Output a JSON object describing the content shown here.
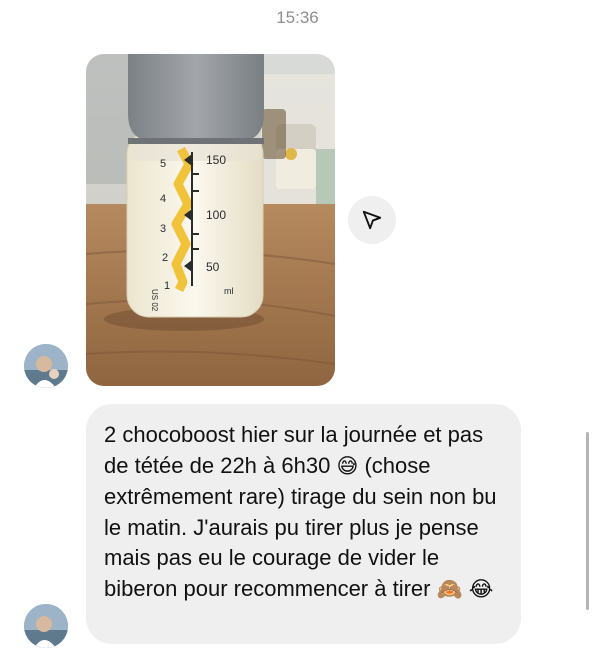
{
  "conversation": {
    "timestamp": "15:36",
    "photo": {
      "bottle_scale_left": [
        "5",
        "4",
        "3",
        "2",
        "1"
      ],
      "bottle_scale_right": [
        "150",
        "100",
        "50"
      ],
      "bottle_unit": "ml",
      "bottle_side_mark": "US 02",
      "fill_level_fraction": 0.93
    },
    "message": {
      "text": "2 chocoboost hier sur la journée et pas de tétée de 22h à 6h30 ",
      "emoji_1": "😅",
      "text_2": " (chose extrêmement rare) tirage du sein non bu le matin. J'aurais pu tirer plus je pense mais pas eu le courage de vider le biberon pour recommencer à tirer ",
      "emoji_2": "🙈",
      "emoji_3": "😂"
    },
    "share_icon": "send-arrow-icon"
  },
  "colors": {
    "bubble": "#efefef",
    "timestamp": "#8e8e8e",
    "milk": "#fbf6e6",
    "cap": "#8e9296"
  }
}
